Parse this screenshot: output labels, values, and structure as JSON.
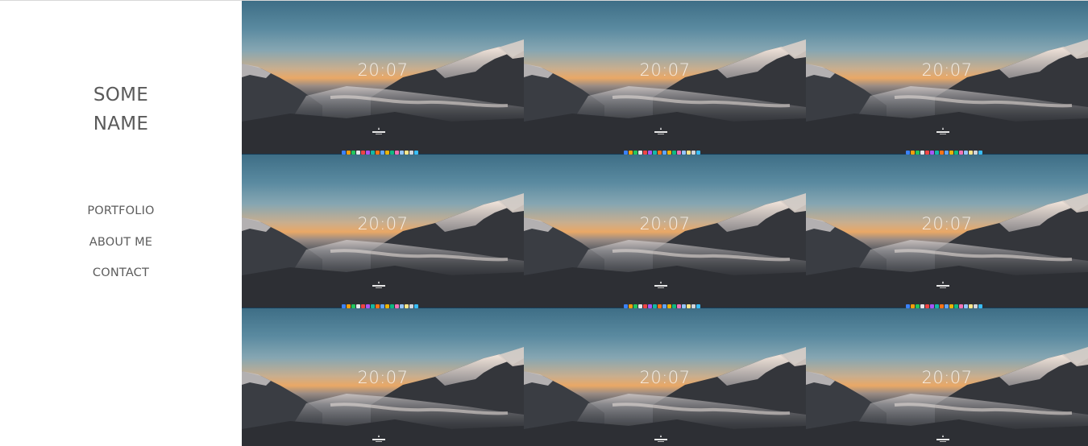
{
  "site": {
    "name_line1": "SOME",
    "name_line2": "NAME"
  },
  "nav": [
    {
      "label": "PORTFOLIO"
    },
    {
      "label": "ABOUT ME"
    },
    {
      "label": "CONTACT"
    }
  ],
  "gallery": {
    "tiles": [
      {
        "clock": "20:07"
      },
      {
        "clock": "20:07"
      },
      {
        "clock": "20:07"
      },
      {
        "clock": "20:07"
      },
      {
        "clock": "20:07"
      },
      {
        "clock": "20:07"
      },
      {
        "clock": "20:07"
      },
      {
        "clock": "20:07"
      },
      {
        "clock": "20:07"
      }
    ],
    "dock_colors": [
      "#3b82f6",
      "#f59e0b",
      "#22c55e",
      "#e5e7eb",
      "#ef4444",
      "#a855f7",
      "#14b8a6",
      "#f97316",
      "#60a5fa",
      "#eab308",
      "#10b981",
      "#f472b6",
      "#93c5fd",
      "#fde68a",
      "#d1d5db",
      "#38bdf8"
    ]
  }
}
